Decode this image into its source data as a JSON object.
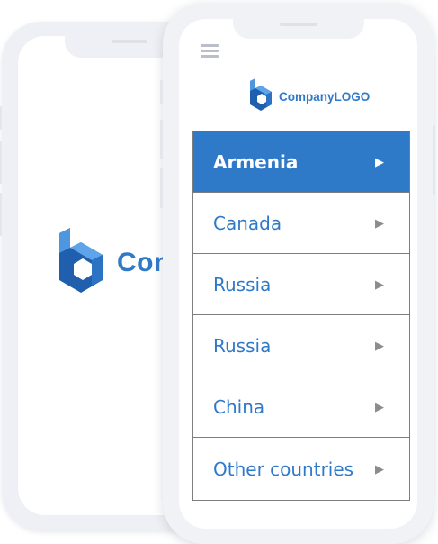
{
  "brand": {
    "name": "CompanyLOGO",
    "back_name_partial": "Com",
    "accent": "#2f79c9"
  },
  "menu": {
    "icon": "hamburger-menu-icon"
  },
  "countries": {
    "items": [
      {
        "label": "Armenia",
        "active": true
      },
      {
        "label": "Canada",
        "active": false
      },
      {
        "label": "Russia",
        "active": false
      },
      {
        "label": "Russia",
        "active": false
      },
      {
        "label": "China",
        "active": false
      },
      {
        "label": "Other countries",
        "active": false
      }
    ],
    "arrow": "▶",
    "arrow_icon": "triangle-right-icon"
  },
  "colors": {
    "accent": "#2f79c9",
    "border": "#7d7d7d",
    "phone_frame": "#eef0f5"
  }
}
